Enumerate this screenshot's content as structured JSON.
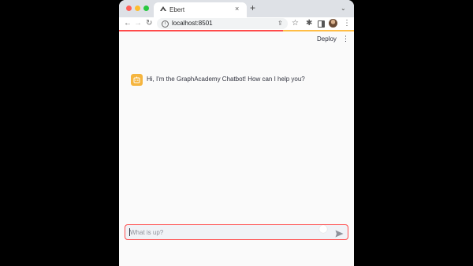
{
  "browser": {
    "tab_title": "Ebert",
    "tab_favicon": "streamlit-icon",
    "tab_close": "×",
    "new_tab": "+",
    "tab_menu": "⌄",
    "back": "←",
    "forward": "→",
    "reload": "↻",
    "url": "localhost:8501",
    "info_icon": "i",
    "share_icon": "⇪",
    "star_icon": "☆",
    "extensions_icon": "✱",
    "menu_icon": "⋮"
  },
  "app": {
    "deploy_label": "Deploy",
    "menu_icon": "⋮",
    "accent_color": "#ff4b4b",
    "loading_gradient_end": "#ffbd45"
  },
  "chat": {
    "messages": [
      {
        "role": "assistant",
        "avatar_icon": "robot-icon",
        "avatar_color": "#f5b53f",
        "text": "Hi, I'm the GraphAcademy Chatbot!  How can I help you?"
      }
    ],
    "input": {
      "value": "",
      "placeholder": "What is up?",
      "send_icon": "send-icon"
    }
  }
}
